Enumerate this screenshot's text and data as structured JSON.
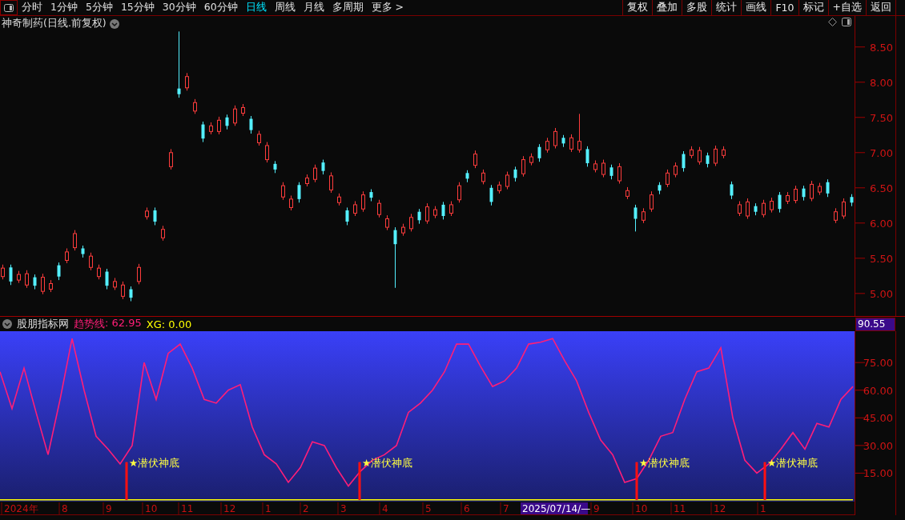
{
  "toolbar": {
    "tabs": [
      {
        "label": "分时",
        "selected": false
      },
      {
        "label": "1分钟",
        "selected": false
      },
      {
        "label": "5分钟",
        "selected": false
      },
      {
        "label": "15分钟",
        "selected": false
      },
      {
        "label": "30分钟",
        "selected": false
      },
      {
        "label": "60分钟",
        "selected": false
      },
      {
        "label": "日线",
        "selected": true
      },
      {
        "label": "周线",
        "selected": false
      },
      {
        "label": "月线",
        "selected": false
      },
      {
        "label": "多周期",
        "selected": false
      },
      {
        "label": "更多 >",
        "selected": false
      }
    ],
    "buttons": [
      "复权",
      "叠加",
      "多股",
      "统计",
      "画线",
      "F10",
      "标记",
      "+自选",
      "返回"
    ]
  },
  "price_chart": {
    "title": "神奇制药(日线.前复权)",
    "chart_data": {
      "type": "candlestick",
      "ylim": [
        4.68,
        8.94
      ],
      "yticks": [
        {
          "value": 8.5,
          "label": "8.50"
        },
        {
          "value": 8,
          "label": "8.00"
        },
        {
          "value": 7.5,
          "label": "7.50"
        },
        {
          "value": 7,
          "label": "7.00"
        },
        {
          "value": 6.5,
          "label": "6.50"
        },
        {
          "value": 6,
          "label": "6.00"
        },
        {
          "value": 5.5,
          "label": "5.50"
        },
        {
          "value": 5,
          "label": "5.00"
        }
      ],
      "ohlc": [
        [
          5.24,
          5.41,
          5.2,
          5.36
        ],
        [
          5.37,
          5.41,
          5.12,
          5.17
        ],
        [
          5.19,
          5.32,
          5.15,
          5.27
        ],
        [
          5.12,
          5.33,
          5.08,
          5.28
        ],
        [
          5.23,
          5.27,
          5.06,
          5.11
        ],
        [
          5.03,
          5.28,
          4.99,
          5.23
        ],
        [
          5.06,
          5.19,
          5.02,
          5.14
        ],
        [
          5.4,
          5.44,
          5.19,
          5.24
        ],
        [
          5.47,
          5.64,
          5.43,
          5.59
        ],
        [
          5.65,
          5.9,
          5.61,
          5.85
        ],
        [
          5.64,
          5.68,
          5.51,
          5.56
        ],
        [
          5.37,
          5.58,
          5.33,
          5.53
        ],
        [
          5.24,
          5.41,
          5.2,
          5.36
        ],
        [
          5.31,
          5.35,
          5.06,
          5.11
        ],
        [
          5.09,
          5.22,
          5.05,
          5.17
        ],
        [
          4.96,
          5.17,
          4.92,
          5.12
        ],
        [
          5.06,
          5.1,
          4.89,
          4.94
        ],
        [
          5.17,
          5.42,
          5.13,
          5.37
        ],
        [
          6.09,
          6.22,
          6.05,
          6.17
        ],
        [
          6.18,
          6.22,
          5.97,
          6.02
        ],
        [
          5.79,
          5.96,
          5.75,
          5.91
        ],
        [
          6.8,
          7.05,
          6.76,
          7.0
        ],
        [
          7.91,
          8.72,
          7.78,
          7.83
        ],
        [
          7.92,
          8.13,
          7.88,
          8.08
        ],
        [
          7.59,
          7.76,
          7.55,
          7.71
        ],
        [
          7.4,
          7.44,
          7.15,
          7.2
        ],
        [
          7.3,
          7.43,
          7.26,
          7.38
        ],
        [
          7.3,
          7.51,
          7.26,
          7.46
        ],
        [
          7.5,
          7.54,
          7.33,
          7.38
        ],
        [
          7.42,
          7.67,
          7.38,
          7.62
        ],
        [
          7.56,
          7.69,
          7.52,
          7.64
        ],
        [
          7.48,
          7.52,
          7.27,
          7.32
        ],
        [
          7.14,
          7.31,
          7.1,
          7.26
        ],
        [
          6.9,
          7.15,
          6.86,
          7.1
        ],
        [
          6.84,
          6.88,
          6.71,
          6.76
        ],
        [
          6.37,
          6.58,
          6.33,
          6.53
        ],
        [
          6.22,
          6.39,
          6.18,
          6.34
        ],
        [
          6.54,
          6.58,
          6.29,
          6.34
        ],
        [
          6.56,
          6.69,
          6.52,
          6.64
        ],
        [
          6.62,
          6.83,
          6.58,
          6.78
        ],
        [
          6.86,
          6.9,
          6.69,
          6.74
        ],
        [
          6.47,
          6.72,
          6.43,
          6.67
        ],
        [
          6.29,
          6.42,
          6.25,
          6.37
        ],
        [
          6.18,
          6.22,
          5.97,
          6.02
        ],
        [
          6.14,
          6.31,
          6.1,
          6.26
        ],
        [
          6.2,
          6.45,
          6.16,
          6.4
        ],
        [
          6.44,
          6.48,
          6.31,
          6.36
        ],
        [
          6.12,
          6.33,
          6.08,
          6.28
        ],
        [
          5.94,
          6.11,
          5.9,
          6.06
        ],
        [
          5.9,
          5.94,
          5.08,
          5.7
        ],
        [
          5.86,
          5.99,
          5.82,
          5.94
        ],
        [
          5.92,
          6.13,
          5.88,
          6.08
        ],
        [
          6.16,
          6.2,
          5.99,
          6.04
        ],
        [
          6.03,
          6.28,
          5.99,
          6.23
        ],
        [
          6.11,
          6.24,
          6.07,
          6.19
        ],
        [
          6.26,
          6.3,
          6.05,
          6.1
        ],
        [
          6.14,
          6.31,
          6.1,
          6.26
        ],
        [
          6.33,
          6.58,
          6.29,
          6.53
        ],
        [
          6.71,
          6.75,
          6.58,
          6.63
        ],
        [
          6.82,
          7.03,
          6.78,
          6.98
        ],
        [
          6.59,
          6.76,
          6.55,
          6.71
        ],
        [
          6.5,
          6.54,
          6.25,
          6.3
        ],
        [
          6.46,
          6.59,
          6.42,
          6.54
        ],
        [
          6.52,
          6.73,
          6.48,
          6.68
        ],
        [
          6.76,
          6.8,
          6.59,
          6.64
        ],
        [
          6.7,
          6.95,
          6.66,
          6.9
        ],
        [
          6.86,
          6.99,
          6.82,
          6.94
        ],
        [
          7.08,
          7.12,
          6.87,
          6.92
        ],
        [
          7.04,
          7.21,
          7.0,
          7.16
        ],
        [
          7.1,
          7.35,
          7.06,
          7.3
        ],
        [
          7.21,
          7.25,
          7.08,
          7.13
        ],
        [
          7.05,
          7.26,
          7.01,
          7.21
        ],
        [
          7.04,
          7.55,
          7.0,
          7.16
        ],
        [
          7.05,
          7.09,
          6.8,
          6.85
        ],
        [
          6.76,
          6.89,
          6.72,
          6.84
        ],
        [
          6.69,
          6.9,
          6.65,
          6.85
        ],
        [
          6.79,
          6.83,
          6.62,
          6.67
        ],
        [
          6.6,
          6.85,
          6.56,
          6.8
        ],
        [
          6.38,
          6.51,
          6.34,
          6.46
        ],
        [
          6.22,
          6.26,
          5.88,
          6.06
        ],
        [
          6.04,
          6.21,
          6.0,
          6.16
        ],
        [
          6.2,
          6.45,
          6.16,
          6.4
        ],
        [
          6.54,
          6.58,
          6.41,
          6.46
        ],
        [
          6.55,
          6.76,
          6.51,
          6.71
        ],
        [
          6.69,
          6.86,
          6.65,
          6.81
        ],
        [
          6.98,
          7.02,
          6.73,
          6.78
        ],
        [
          6.96,
          7.09,
          6.92,
          7.04
        ],
        [
          6.87,
          7.08,
          6.83,
          7.03
        ],
        [
          6.96,
          7.0,
          6.79,
          6.84
        ],
        [
          6.85,
          7.1,
          6.81,
          7.05
        ],
        [
          6.96,
          7.09,
          6.92,
          7.04
        ],
        [
          6.55,
          6.59,
          6.34,
          6.39
        ],
        [
          6.14,
          6.31,
          6.1,
          6.26
        ],
        [
          6.1,
          6.35,
          6.06,
          6.3
        ],
        [
          6.24,
          6.28,
          6.11,
          6.16
        ],
        [
          6.12,
          6.33,
          6.08,
          6.28
        ],
        [
          6.19,
          6.36,
          6.15,
          6.31
        ],
        [
          6.4,
          6.44,
          6.15,
          6.2
        ],
        [
          6.31,
          6.44,
          6.27,
          6.39
        ],
        [
          6.32,
          6.53,
          6.28,
          6.48
        ],
        [
          6.49,
          6.53,
          6.32,
          6.37
        ],
        [
          6.35,
          6.6,
          6.31,
          6.55
        ],
        [
          6.44,
          6.57,
          6.4,
          6.52
        ],
        [
          6.58,
          6.62,
          6.37,
          6.42
        ],
        [
          6.04,
          6.21,
          6.0,
          6.16
        ],
        [
          6.1,
          6.35,
          6.06,
          6.3
        ],
        [
          6.37,
          6.41,
          6.24,
          6.29
        ]
      ]
    }
  },
  "indicator": {
    "title": "股朋指标网",
    "legend": [
      ": 62.95",
      ": 0.00"
    ],
    "cursor_value": "90.55",
    "chart_data": {
      "type": "line",
      "ylim": [
        0,
        92
      ],
      "yticks": [
        {
          "value": 15,
          "label": "15.00"
        },
        {
          "value": 30,
          "label": "30.00"
        },
        {
          "value": 45,
          "label": "45.00"
        },
        {
          "value": 60,
          "label": "60.00"
        },
        {
          "value": 75,
          "label": "75.00"
        }
      ],
      "series": [
        {
          "name": "趋势线",
          "color": "#ff1e78",
          "values": [
            70,
            50,
            72,
            48,
            25,
            55,
            88,
            60,
            35,
            28,
            20,
            30,
            75,
            55,
            80,
            85,
            72,
            55,
            53,
            60,
            63,
            40,
            25,
            20,
            10,
            18,
            32,
            30,
            18,
            8,
            16,
            22,
            25,
            30,
            48,
            53,
            60,
            70,
            85,
            85,
            73,
            62,
            65,
            72,
            85,
            86,
            88,
            76,
            65,
            48,
            33,
            25,
            10,
            12,
            22,
            35,
            37,
            55,
            70,
            72,
            83,
            45,
            22,
            15,
            20,
            28,
            37,
            28,
            42,
            40,
            55,
            62
          ]
        },
        {
          "name": "XG",
          "color": "#ffff00",
          "values": [
            0,
            0,
            0,
            0,
            0,
            0,
            0,
            0,
            0,
            0,
            0,
            0,
            0,
            0,
            0,
            0,
            0,
            0,
            0,
            0,
            0,
            0,
            0,
            0,
            0,
            0,
            0,
            0,
            0,
            0,
            0,
            0,
            0,
            0,
            0,
            0,
            0,
            0,
            0,
            0,
            0,
            0,
            0,
            0,
            0,
            0,
            0,
            0,
            0,
            0,
            0,
            0,
            0,
            0,
            0,
            0,
            0,
            0,
            0,
            0,
            0,
            0,
            0,
            0,
            0,
            0,
            0,
            0,
            0,
            0,
            0,
            0
          ]
        }
      ]
    },
    "signals": [
      {
        "label": "★潜伏神底"
      },
      {
        "label": "★潜伏神底"
      },
      {
        "label": "★潜伏神底"
      },
      {
        "label": "★潜伏神底"
      }
    ],
    "date_axis": [
      "2024年",
      "8",
      "9",
      "10",
      "11",
      "12",
      "1",
      "2",
      "3",
      "4",
      "5",
      "6",
      "7",
      "9",
      "10",
      "11",
      "12",
      "1"
    ],
    "cursor_date": "2025/07/14/—"
  }
}
